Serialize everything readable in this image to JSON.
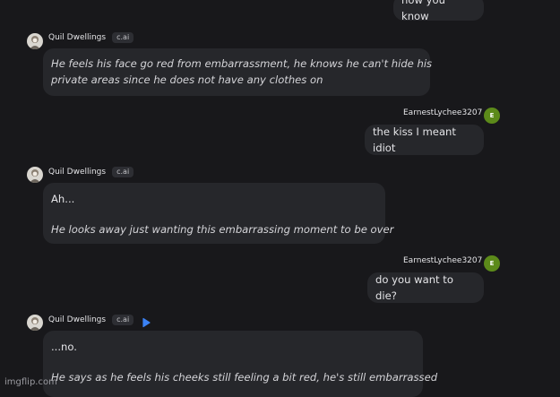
{
  "bot": {
    "name": "Quil Dwellings",
    "tag": "c.ai"
  },
  "user": {
    "name": "EarnestLychee3207",
    "initial": "E"
  },
  "messages": [
    {
      "text": "now you know"
    },
    {
      "lines": [
        "He feels his face go red from embarrassment, he knows he can't hide his",
        "private areas since he does not have any clothes on"
      ]
    },
    {
      "text": "the kiss I meant idiot"
    },
    {
      "p1": "Ah...",
      "p2": "He looks away just wanting this embarrassing moment to be over"
    },
    {
      "text": "do you want to die?"
    },
    {
      "p1": "...no.",
      "p2": "He says as he feels his cheeks still feeling a bit red, he's still embarrassed"
    }
  ],
  "watermark": "imgflip.com",
  "colors": {
    "background": "#18181b",
    "bubble": "#26272b",
    "user_avatar": "#5c8a1a",
    "play_icon": "#3b82f6"
  },
  "icons": {
    "play": "play-icon"
  }
}
